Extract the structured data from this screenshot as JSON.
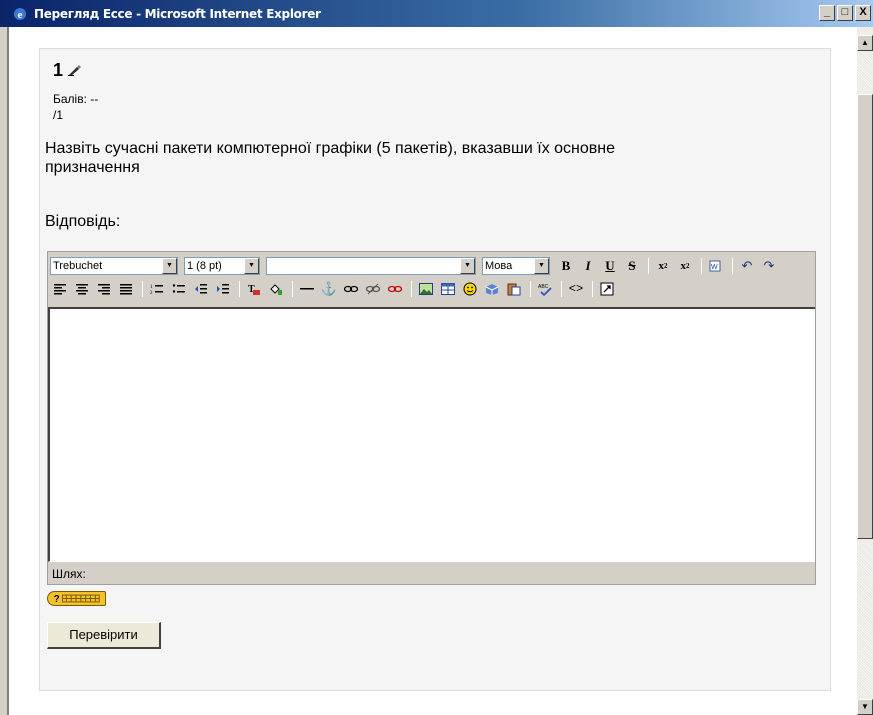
{
  "window": {
    "title": "Перегляд Ессе - Microsoft Internet Explorer",
    "buttons": {
      "minimize": "_",
      "maximize": "□",
      "close": "X"
    }
  },
  "question": {
    "number": "1",
    "grade_label": "Балів: --",
    "grade_max": "/1",
    "text": "Назвіть сучасні пакети компютерної графіки (5 пакетів), вказавши їх основне призначення",
    "answer_label": "Відповідь:"
  },
  "editor": {
    "font_family": "Trebuchet",
    "font_size": "1 (8 pt)",
    "style": "",
    "language": "Мова",
    "path_label": "Шлях:",
    "content": ""
  },
  "submit": {
    "label": "Перевірити"
  },
  "icons": [
    "ie-icon",
    "edit-icon",
    "bold-icon",
    "italic-icon",
    "underline-icon",
    "strike-icon",
    "subscript-icon",
    "superscript-icon",
    "clean-word-icon",
    "undo-icon",
    "redo-icon",
    "align-left-icon",
    "align-center-icon",
    "align-right-icon",
    "justify-icon",
    "ordered-list-icon",
    "unordered-list-icon",
    "outdent-icon",
    "indent-icon",
    "text-color-icon",
    "bg-color-icon",
    "hr-icon",
    "anchor-icon",
    "link-icon",
    "unlink-icon",
    "nolink-icon",
    "image-icon",
    "table-icon",
    "smiley-icon",
    "special-char-icon",
    "paste-icon",
    "spellcheck-icon",
    "html-source-icon",
    "fullscreen-icon",
    "help-keyboard-icon"
  ]
}
